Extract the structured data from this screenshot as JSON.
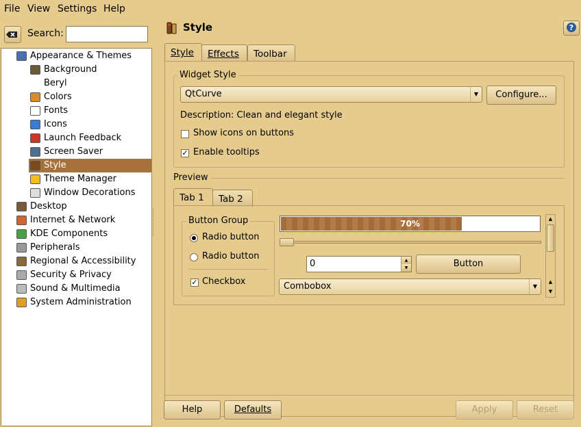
{
  "menubar": {
    "items": [
      "File",
      "View",
      "Settings",
      "Help"
    ]
  },
  "search": {
    "label": "Search:",
    "value": ""
  },
  "tree": {
    "items": [
      {
        "label": "Appearance & Themes",
        "level": 0,
        "expanded": true,
        "icon": "appearance-icon"
      },
      {
        "label": "Background",
        "level": 1,
        "icon": "background-icon"
      },
      {
        "label": "Beryl",
        "level": 1,
        "icon": ""
      },
      {
        "label": "Colors",
        "level": 1,
        "icon": "colors-icon"
      },
      {
        "label": "Fonts",
        "level": 1,
        "icon": "fonts-icon"
      },
      {
        "label": "Icons",
        "level": 1,
        "icon": "icons-icon"
      },
      {
        "label": "Launch Feedback",
        "level": 1,
        "icon": "launch-feedback-icon"
      },
      {
        "label": "Screen Saver",
        "level": 1,
        "icon": "screen-saver-icon"
      },
      {
        "label": "Style",
        "level": 1,
        "selected": true,
        "icon": "style-icon"
      },
      {
        "label": "Theme Manager",
        "level": 1,
        "icon": "theme-manager-icon"
      },
      {
        "label": "Window Decorations",
        "level": 1,
        "icon": "window-decorations-icon"
      },
      {
        "label": "Desktop",
        "level": 0,
        "icon": "desktop-icon"
      },
      {
        "label": "Internet & Network",
        "level": 0,
        "icon": "network-icon"
      },
      {
        "label": "KDE Components",
        "level": 0,
        "icon": "kde-components-icon"
      },
      {
        "label": "Peripherals",
        "level": 0,
        "icon": "peripherals-icon"
      },
      {
        "label": "Regional & Accessibility",
        "level": 0,
        "icon": "regional-icon"
      },
      {
        "label": "Security & Privacy",
        "level": 0,
        "icon": "security-icon"
      },
      {
        "label": "Sound & Multimedia",
        "level": 0,
        "icon": "sound-icon"
      },
      {
        "label": "System Administration",
        "level": 0,
        "icon": "system-admin-icon"
      }
    ]
  },
  "module": {
    "title": "Style",
    "help": "?"
  },
  "tabs": [
    "Style",
    "Effects",
    "Toolbar"
  ],
  "widget_style": {
    "group_title": "Widget Style",
    "combo_value": "QtCurve",
    "configure_label": "Configure...",
    "description": "Description: Clean and elegant style",
    "show_icons_label": "Show icons on buttons",
    "show_icons_checked": false,
    "enable_tooltips_label": "Enable tooltips",
    "enable_tooltips_checked": true
  },
  "preview": {
    "title": "Preview",
    "tabs": [
      "Tab 1",
      "Tab 2"
    ],
    "button_group_title": "Button Group",
    "radio1": "Radio button",
    "radio2": "Radio button",
    "checkbox": "Checkbox",
    "progress_text": "70%",
    "progress_value": 0.7,
    "slider_value": 0,
    "spin_value": "0",
    "button_label": "Button",
    "combobox_value": "Combobox"
  },
  "footer": {
    "help": "Help",
    "defaults": "Defaults",
    "apply": "Apply",
    "reset": "Reset"
  },
  "colors": {
    "background": "#e6cb8f",
    "selection": "#a7713c",
    "progress": "#a56d3c"
  }
}
